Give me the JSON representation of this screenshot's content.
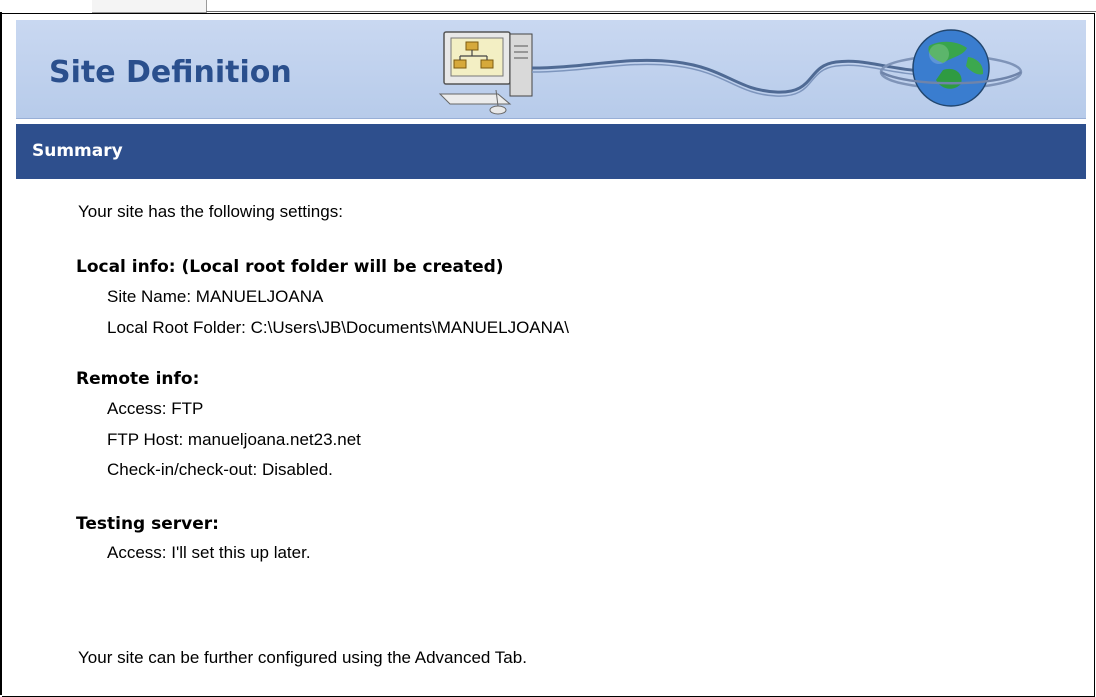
{
  "banner": {
    "title": "Site Definition",
    "art_icons": [
      "computer-icon",
      "globe-icon"
    ]
  },
  "section": {
    "title": "Summary"
  },
  "summary": {
    "intro": "Your site has the following settings:",
    "local_info": {
      "heading": "Local info: (Local root folder will be created)",
      "site_name": "Site Name: MANUELJOANA",
      "local_root": "Local Root Folder: C:\\Users\\JB\\Documents\\MANUELJOANA\\"
    },
    "remote_info": {
      "heading": "Remote info:",
      "access": "Access: FTP",
      "ftp_host": "FTP Host: manueljoana.net23.net",
      "checkin": "Check-in/check-out: Disabled."
    },
    "testing_server": {
      "heading": "Testing server:",
      "access": "Access: I'll set this up later."
    },
    "footer": "Your site can be further configured using the Advanced Tab."
  },
  "colors": {
    "banner_bg": "#c9d8f1",
    "section_bar": "#2e4f8d",
    "title_blue": "#2a4f8d"
  }
}
